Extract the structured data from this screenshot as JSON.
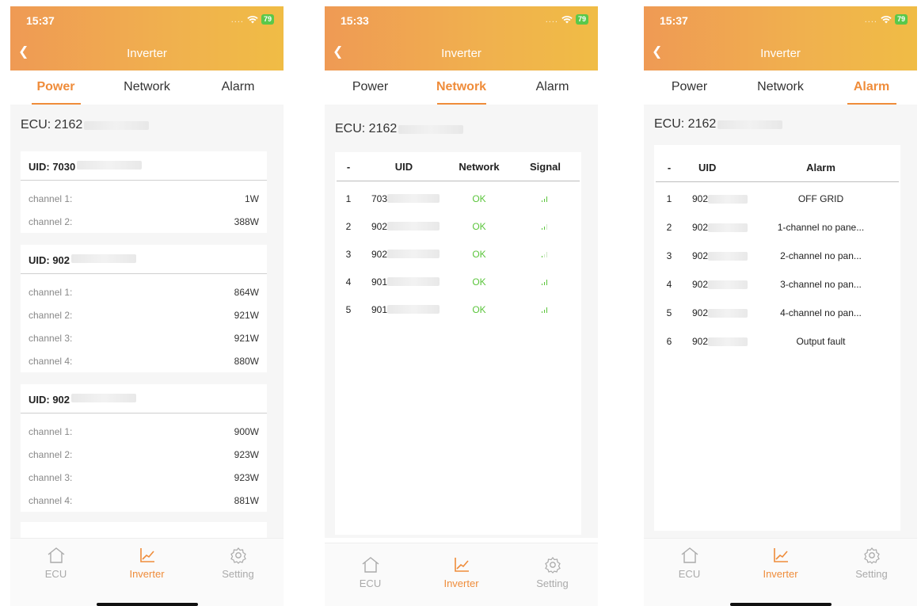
{
  "colors": {
    "accent": "#ef8c3a",
    "ok": "#5bc53c",
    "header_start": "#ef9a54",
    "header_end": "#f0bc45"
  },
  "screens": [
    {
      "time": "15:37",
      "battery": "79",
      "title": "Inverter",
      "tabs": [
        "Power",
        "Network",
        "Alarm"
      ],
      "active_tab": "Power",
      "ecu_label": "ECU: 2162",
      "cards": [
        {
          "uid": "UID: 7030",
          "channels": [
            {
              "label": "channel 1:",
              "value": "1W"
            },
            {
              "label": "channel 2:",
              "value": "388W"
            }
          ]
        },
        {
          "uid": "UID: 902",
          "channels": [
            {
              "label": "channel 1:",
              "value": "864W"
            },
            {
              "label": "channel 2:",
              "value": "921W"
            },
            {
              "label": "channel 3:",
              "value": "921W"
            },
            {
              "label": "channel 4:",
              "value": "880W"
            }
          ]
        },
        {
          "uid": "UID: 902",
          "channels": [
            {
              "label": "channel 1:",
              "value": "900W"
            },
            {
              "label": "channel 2:",
              "value": "923W"
            },
            {
              "label": "channel 3:",
              "value": "923W"
            },
            {
              "label": "channel 4:",
              "value": "881W"
            }
          ]
        }
      ]
    },
    {
      "time": "15:33",
      "battery": "79",
      "title": "Inverter",
      "tabs": [
        "Power",
        "Network",
        "Alarm"
      ],
      "active_tab": "Network",
      "ecu_label": "ECU: 2162",
      "columns": [
        "-",
        "UID",
        "Network",
        "Signal"
      ],
      "rows": [
        {
          "idx": "1",
          "uid": "703",
          "network": "OK"
        },
        {
          "idx": "2",
          "uid": "902",
          "network": "OK"
        },
        {
          "idx": "3",
          "uid": "902",
          "network": "OK"
        },
        {
          "idx": "4",
          "uid": "901",
          "network": "OK"
        },
        {
          "idx": "5",
          "uid": "901",
          "network": "OK"
        }
      ]
    },
    {
      "time": "15:37",
      "battery": "79",
      "title": "Inverter",
      "tabs": [
        "Power",
        "Network",
        "Alarm"
      ],
      "active_tab": "Alarm",
      "ecu_label": "ECU: 2162",
      "columns": [
        "-",
        "UID",
        "Alarm"
      ],
      "rows": [
        {
          "idx": "1",
          "uid": "902",
          "alarm": "OFF GRID"
        },
        {
          "idx": "2",
          "uid": "902",
          "alarm": "1-channel no pane..."
        },
        {
          "idx": "3",
          "uid": "902",
          "alarm": "2-channel no pan..."
        },
        {
          "idx": "4",
          "uid": "902",
          "alarm": "3-channel no pan..."
        },
        {
          "idx": "5",
          "uid": "902",
          "alarm": "4-channel no pan..."
        },
        {
          "idx": "6",
          "uid": "902",
          "alarm": "Output fault"
        }
      ]
    }
  ],
  "bottom_nav": [
    {
      "label": "ECU",
      "icon": "house-icon"
    },
    {
      "label": "Inverter",
      "icon": "chart-icon"
    },
    {
      "label": "Setting",
      "icon": "gear-icon"
    }
  ]
}
